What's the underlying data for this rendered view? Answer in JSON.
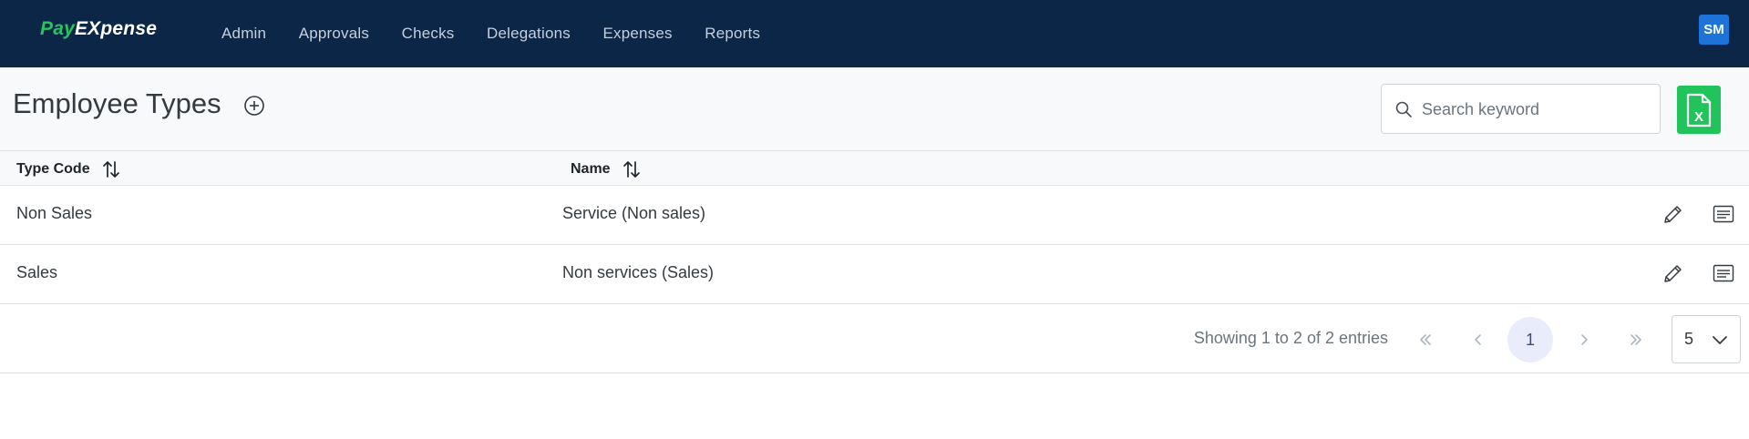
{
  "app": {
    "logo_pay": "Pay",
    "logo_expense": "EXpense"
  },
  "nav": {
    "items": [
      "Admin",
      "Approvals",
      "Checks",
      "Delegations",
      "Expenses",
      "Reports"
    ]
  },
  "user": {
    "initials": "SM"
  },
  "page": {
    "title": "Employee Types"
  },
  "search": {
    "placeholder": "Search keyword",
    "value": ""
  },
  "table": {
    "columns": [
      "Type Code",
      "Name"
    ],
    "rows": [
      {
        "type_code": "Non Sales",
        "name": "Service (Non sales)"
      },
      {
        "type_code": "Sales",
        "name": "Non services (Sales)"
      }
    ]
  },
  "pagination": {
    "showing": "Showing 1 to 2 of 2 entries",
    "first": "«",
    "prev": "‹",
    "current_page": "1",
    "next": "›",
    "last": "»",
    "page_size": "5"
  },
  "icons": {
    "add": "plus-circle-icon",
    "search": "search-icon",
    "excel": "excel-file-icon",
    "sort": "sort-icon",
    "edit": "pencil-icon",
    "detail": "detail-list-icon",
    "chevron": "chevron-down-icon"
  },
  "colors": {
    "navbar": "#0b2646",
    "logo_accent": "#22c55e",
    "avatar": "#1e73d8",
    "excel": "#21c45a",
    "active_page": "#e9edfb"
  },
  "excel": {
    "letter": "X"
  }
}
